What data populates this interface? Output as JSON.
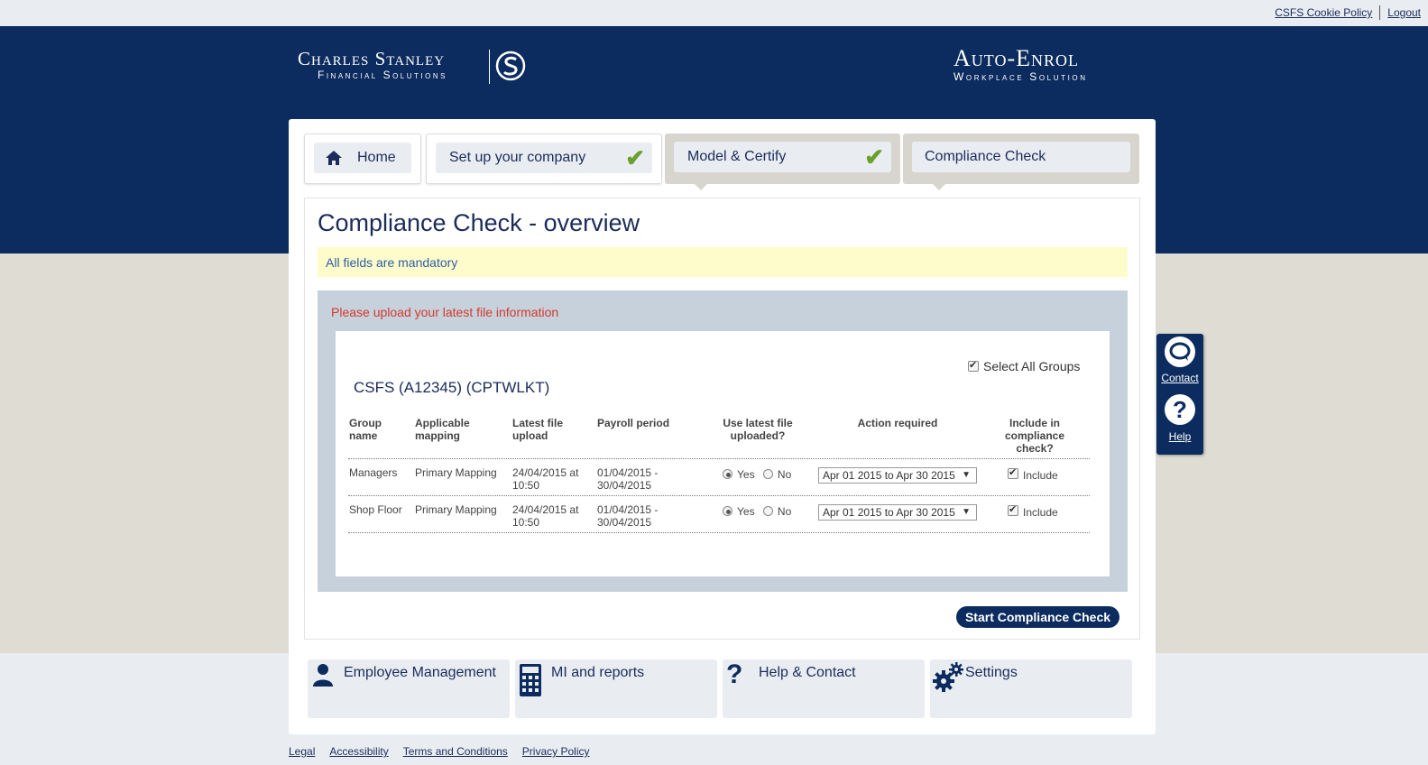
{
  "top_links": {
    "cookie_policy": "CSFS Cookie Policy",
    "logout": "Logout"
  },
  "brand": {
    "left_line1": "Charles Stanley",
    "left_line2": "Financial Solutions",
    "right_line1": "Auto-Enrol",
    "right_line2": "Workplace Solution"
  },
  "tabs": [
    {
      "label": "Home",
      "icon": "home-icon",
      "state": "active"
    },
    {
      "label": "Set up your company",
      "icon": "checkmark-icon",
      "state": "complete"
    },
    {
      "label": "Model & Certify",
      "icon": "checkmark-icon",
      "state": "complete"
    },
    {
      "label": "Compliance Check",
      "state": "current"
    }
  ],
  "main": {
    "title": "Compliance Check - overview",
    "mandatory": "All fields are mandatory",
    "upload_message": "Please upload your latest file information",
    "select_all": "Select All Groups",
    "select_all_checked": true,
    "company": "CSFS (A12345) (CPTWLKT)"
  },
  "table": {
    "headers": {
      "group_name": "Group name",
      "applicable_mapping": "Applicable mapping",
      "latest_file_upload": "Latest file upload",
      "payroll_period": "Payroll period",
      "use_latest": "Use latest file uploaded?",
      "action_required": "Action required",
      "include": "Include in compliance check?"
    },
    "rows": [
      {
        "group_name": "Managers",
        "mapping": "Primary Mapping",
        "upload_date": "24/04/2015 at",
        "upload_time": "10:50",
        "payroll_from": "01/04/2015 -",
        "payroll_to": "30/04/2015",
        "yes_label": "Yes",
        "no_label": "No",
        "use_latest": "Yes",
        "action": "Apr 01 2015 to Apr 30 2015",
        "include_label": "Include",
        "include_checked": true
      },
      {
        "group_name": "Shop Floor",
        "mapping": "Primary Mapping",
        "upload_date": "24/04/2015 at",
        "upload_time": "10:50",
        "payroll_from": "01/04/2015 -",
        "payroll_to": "30/04/2015",
        "yes_label": "Yes",
        "no_label": "No",
        "use_latest": "Yes",
        "action": "Apr 01 2015 to Apr 30 2015",
        "include_label": "Include",
        "include_checked": true
      }
    ]
  },
  "start_button": "Start Compliance Check",
  "bottom_nav": [
    {
      "label": "Employee Management",
      "icon": "person-icon"
    },
    {
      "label": "MI and reports",
      "icon": "calculator-icon"
    },
    {
      "label": "Help & Contact",
      "icon": "question-icon"
    },
    {
      "label": "Settings",
      "icon": "gears-icon"
    }
  ],
  "side_panel": {
    "contact": "Contact",
    "help": "Help"
  },
  "footer": [
    "Legal",
    "Accessibility",
    "Terms and Conditions",
    "Privacy Policy"
  ],
  "colors": {
    "navy": "#0c2b5e",
    "beige": "#dedcd3",
    "pale_blue": "#e9edf2",
    "check_green": "#6aa12b",
    "alert_red": "#d33a2c",
    "mandatory_bg": "#fdfcca"
  }
}
